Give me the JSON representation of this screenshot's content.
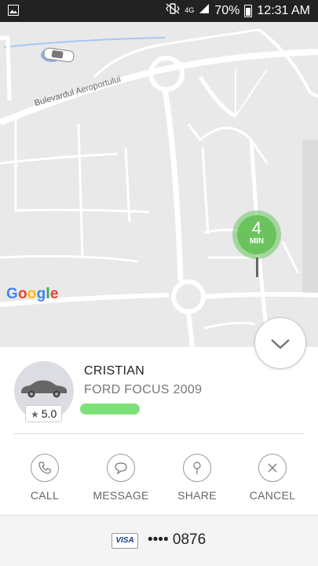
{
  "status_bar": {
    "battery": "70%",
    "time": "12:31 AM",
    "network": "4G"
  },
  "map": {
    "road_label": "Bulevardul Aeroportului",
    "logo": "Google",
    "eta_value": "4",
    "eta_unit": "MIN"
  },
  "driver": {
    "name": "CRISTIAN",
    "car": "FORD FOCUS 2009",
    "rating": "5.0"
  },
  "actions": [
    {
      "label": "CALL",
      "icon": "phone-icon"
    },
    {
      "label": "MESSAGE",
      "icon": "chat-bubble-icon"
    },
    {
      "label": "SHARE",
      "icon": "pin-icon"
    },
    {
      "label": "CANCEL",
      "icon": "close-icon"
    }
  ],
  "payment": {
    "card_brand": "VISA",
    "card_number": "•••• 0876"
  },
  "colors": {
    "eta_green": "#6bc35d",
    "plate_highlight": "#7ee07a"
  }
}
